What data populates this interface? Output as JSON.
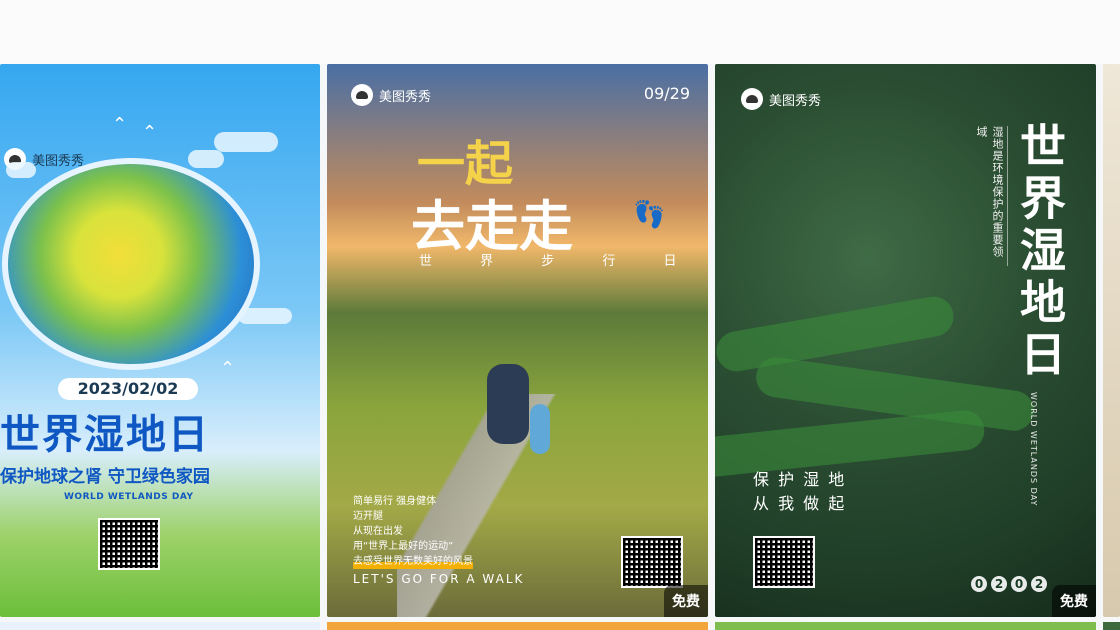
{
  "cards": [
    {
      "brand": "美图秀秀",
      "date": "2023/02/02",
      "title": "世界湿地日",
      "subtitle": "保护地球之肾 守卫绿色家园",
      "english": "WORLD WETLANDS DAY"
    },
    {
      "brand": "美图秀秀",
      "date": "09/29",
      "title_top": "一起",
      "title_bottom": "去走走",
      "subtitle": "世 界 步 行 日",
      "text_lines": [
        "简单易行 强身健体",
        "迈开腿",
        "从现在出发",
        "用“世界上最好的运动”",
        "去感受世界无数美好的风景"
      ],
      "english": "LET'S GO FOR  A WALK",
      "free_badge": "免费"
    },
    {
      "brand": "美图秀秀",
      "vertical_note": "湿地是环境保护的重要领域",
      "vertical_title": "世界湿地日",
      "vertical_en": "WORLD WETLANDS DAY",
      "slogan_line1": "保 护 湿 地",
      "slogan_line2": "从 我 做 起",
      "digits": [
        "0",
        "2",
        "0",
        "2"
      ],
      "free_badge": "免费"
    }
  ]
}
